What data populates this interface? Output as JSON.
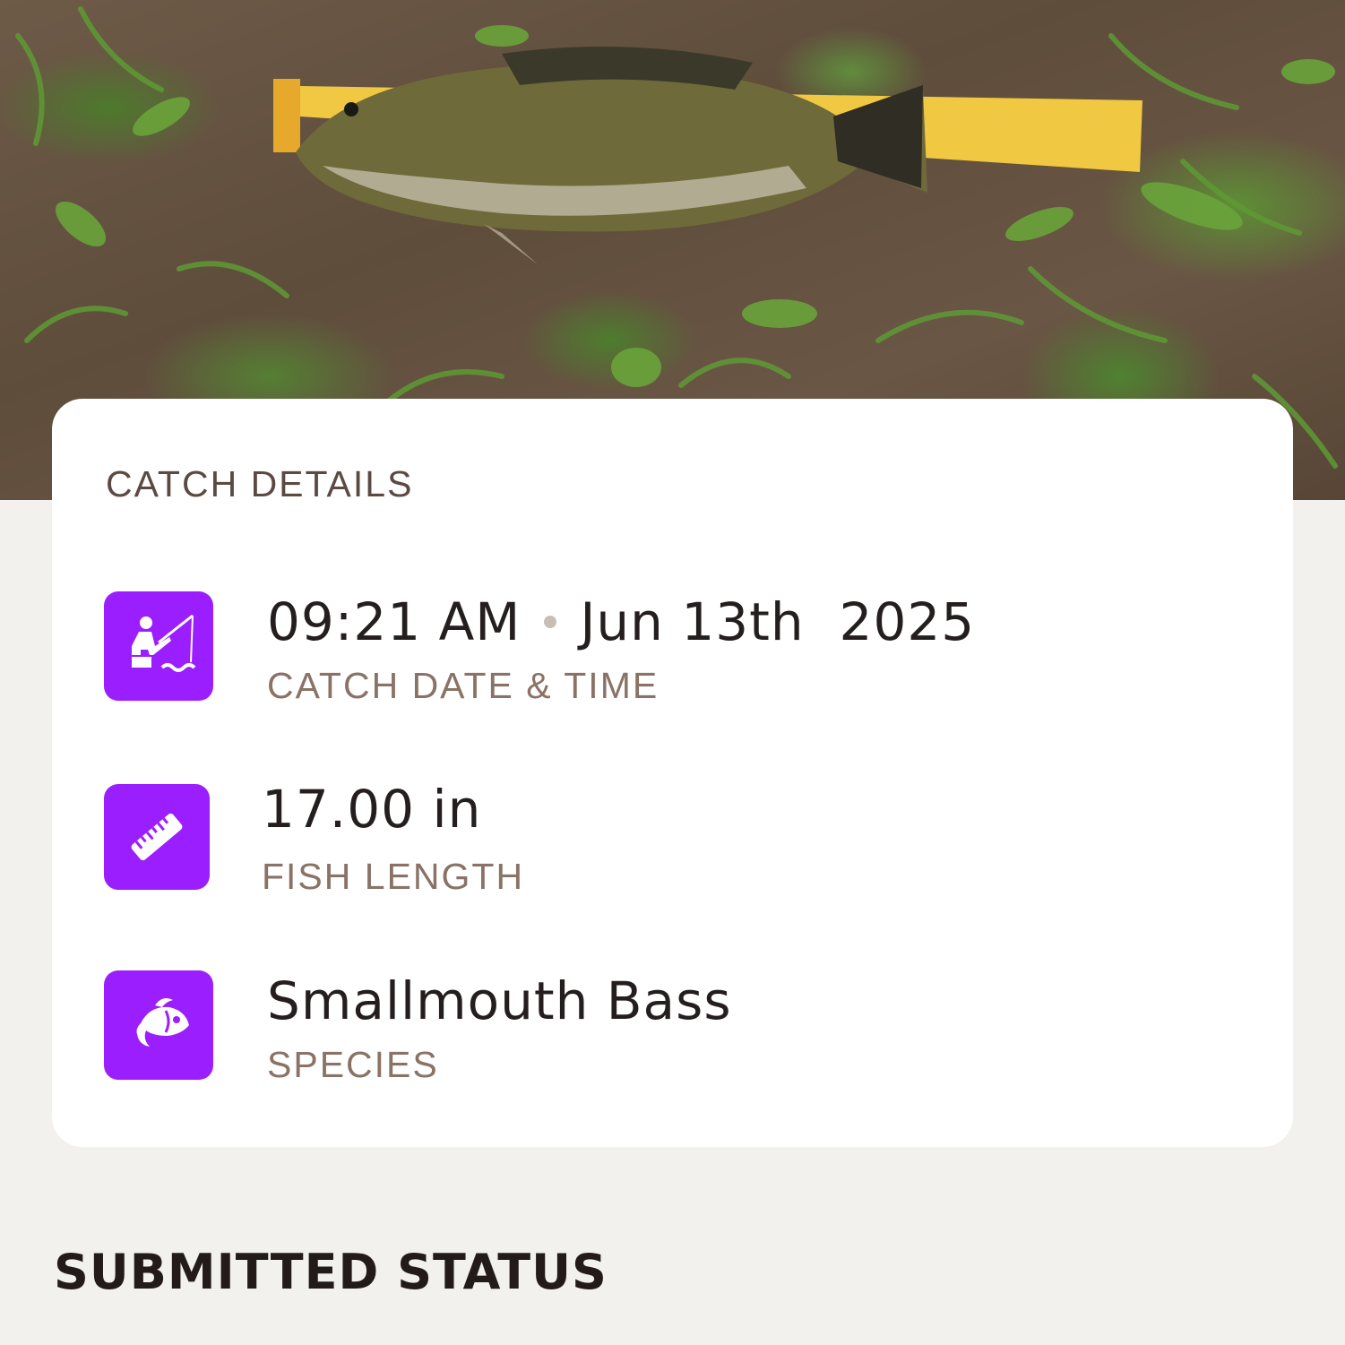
{
  "photo": {
    "subject": "fish-on-measuring-board"
  },
  "catch_details": {
    "title": "CATCH DETAILS",
    "datetime": {
      "time": "09:21 AM",
      "date": "Jun 13th  2025",
      "label": "CATCH DATE & TIME",
      "icon": "fisherman-icon"
    },
    "length": {
      "value": "17.00 in",
      "label": "FISH LENGTH",
      "icon": "ruler-icon"
    },
    "species": {
      "value": "Smallmouth Bass",
      "label": "SPECIES",
      "icon": "fish-icon"
    }
  },
  "submitted_status": {
    "title": "SUBMITTED STATUS"
  },
  "colors": {
    "accent": "#9b1eff",
    "background": "#f2f1ee",
    "card": "#ffffff",
    "label": "#8a7366"
  }
}
